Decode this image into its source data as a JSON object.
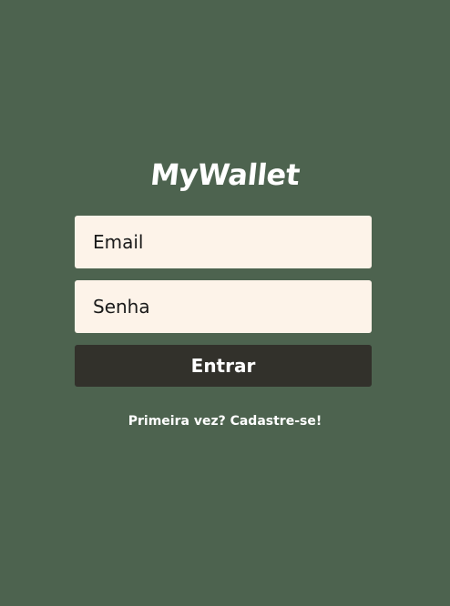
{
  "app": {
    "logo_text": "MyWallet"
  },
  "login_form": {
    "email_placeholder": "Email",
    "password_placeholder": "Senha",
    "submit_label": "Entrar",
    "signup_link": "Primeira vez? Cadastre-se!"
  },
  "colors": {
    "background": "#4d634f",
    "input_background": "#fdf3e9",
    "button_background": "#32312b",
    "text_light": "#ffffff"
  }
}
